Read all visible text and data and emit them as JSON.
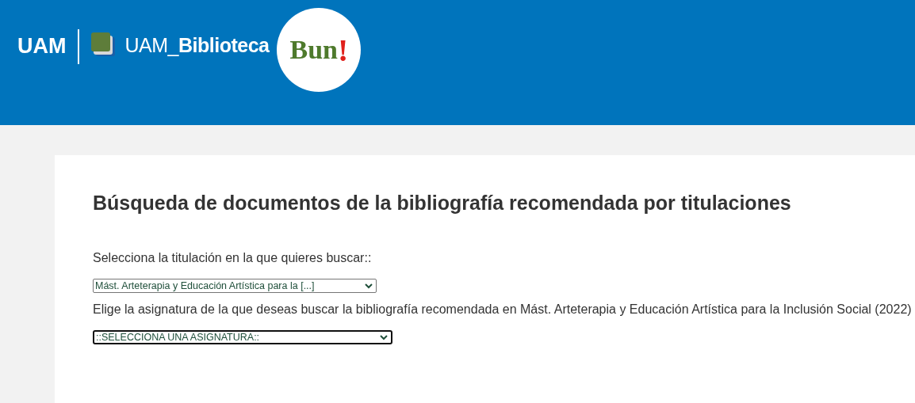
{
  "header": {
    "uam_logo": "UAM",
    "library_name_light": "UAM_",
    "library_name_bold": "Biblioteca",
    "bun_logo_text": "Bun",
    "bun_logo_mark": "!"
  },
  "title": "Búsqueda de documentos de la bibliografía recomendada por titulaciones",
  "form": [
    {
      "label": "Selecciona la titulación en la que quieres buscar::",
      "value": "Mást. Arteterapia y Educación Artística para la [...]",
      "focused": false
    },
    {
      "label": "Elige la asignatura de la que deseas buscar la bibliografía recomendada en Mást. Arteterapia y Educación Artística para la Inclusión Social (2022)",
      "value": "::SELECCIONA UNA ASIGNATURA::",
      "focused": true
    }
  ]
}
